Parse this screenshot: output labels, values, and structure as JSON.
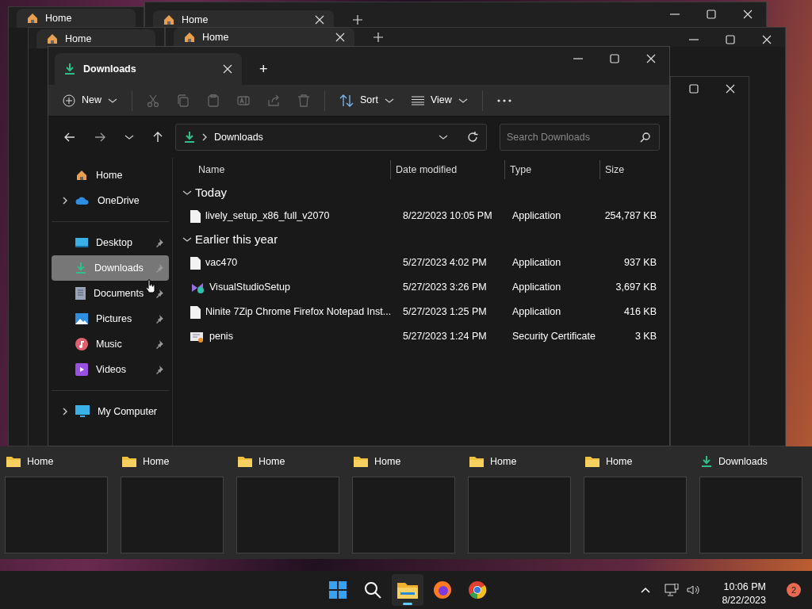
{
  "background_windows": [
    {
      "tab": "Home"
    },
    {
      "tab": "Home"
    },
    {
      "tab": "Home"
    },
    {
      "tab": "Home"
    }
  ],
  "window": {
    "tab": "Downloads",
    "new_tab": "+",
    "toolbar": {
      "new": "New",
      "sort": "Sort",
      "view": "View"
    },
    "address": {
      "crumb": "Downloads"
    },
    "search": {
      "placeholder": "Search Downloads"
    },
    "sidebar": {
      "sections": [
        [
          {
            "label": "Home",
            "kind": "home",
            "expandable": false,
            "pinned": false,
            "selected": false
          },
          {
            "label": "OneDrive",
            "kind": "cloud",
            "expandable": true,
            "pinned": false,
            "selected": false
          }
        ],
        [
          {
            "label": "Desktop",
            "kind": "desktop",
            "expandable": false,
            "pinned": true,
            "selected": false
          },
          {
            "label": "Downloads",
            "kind": "download",
            "expandable": false,
            "pinned": true,
            "selected": true
          },
          {
            "label": "Documents",
            "kind": "document",
            "expandable": false,
            "pinned": true,
            "selected": false
          },
          {
            "label": "Pictures",
            "kind": "picture",
            "expandable": false,
            "pinned": true,
            "selected": false
          },
          {
            "label": "Music",
            "kind": "music",
            "expandable": false,
            "pinned": true,
            "selected": false
          },
          {
            "label": "Videos",
            "kind": "video",
            "expandable": false,
            "pinned": true,
            "selected": false
          }
        ],
        [
          {
            "label": "My Computer",
            "kind": "computer",
            "expandable": true,
            "pinned": false,
            "selected": false
          }
        ]
      ]
    },
    "columns": [
      "Name",
      "Date modified",
      "Type",
      "Size"
    ],
    "groups": [
      {
        "label": "Today",
        "expanded": true,
        "rows": [
          {
            "name": "lively_setup_x86_full_v2070",
            "date": "8/22/2023 10:05 PM",
            "type": "Application",
            "size": "254,787 KB",
            "kind": "file"
          }
        ]
      },
      {
        "label": "Earlier this year",
        "expanded": true,
        "rows": [
          {
            "name": "vac470",
            "date": "5/27/2023 4:02 PM",
            "type": "Application",
            "size": "937 KB",
            "kind": "file"
          },
          {
            "name": "VisualStudioSetup",
            "date": "5/27/2023 3:26 PM",
            "type": "Application",
            "size": "3,697 KB",
            "kind": "installer"
          },
          {
            "name": "Ninite 7Zip Chrome Firefox Notepad Inst...",
            "date": "5/27/2023 1:25 PM",
            "type": "Application",
            "size": "416 KB",
            "kind": "file"
          },
          {
            "name": "penis",
            "date": "5/27/2023 1:24 PM",
            "type": "Security Certificate",
            "size": "3 KB",
            "kind": "certificate"
          }
        ]
      }
    ]
  },
  "switcher": {
    "items": [
      {
        "title": "Home",
        "kind": "folder"
      },
      {
        "title": "Home",
        "kind": "folder"
      },
      {
        "title": "Home",
        "kind": "folder"
      },
      {
        "title": "Home",
        "kind": "folder"
      },
      {
        "title": "Home",
        "kind": "folder"
      },
      {
        "title": "Home",
        "kind": "folder"
      },
      {
        "title": "Downloads",
        "kind": "download"
      }
    ]
  },
  "taskbar": {
    "apps": [
      {
        "kind": "start",
        "active": false
      },
      {
        "kind": "search",
        "active": false
      },
      {
        "kind": "explorer",
        "active": true
      },
      {
        "kind": "firefox",
        "active": false
      },
      {
        "kind": "chrome",
        "active": false
      }
    ],
    "time": "10:06 PM",
    "date": "8/22/2023",
    "notifications": "2"
  }
}
